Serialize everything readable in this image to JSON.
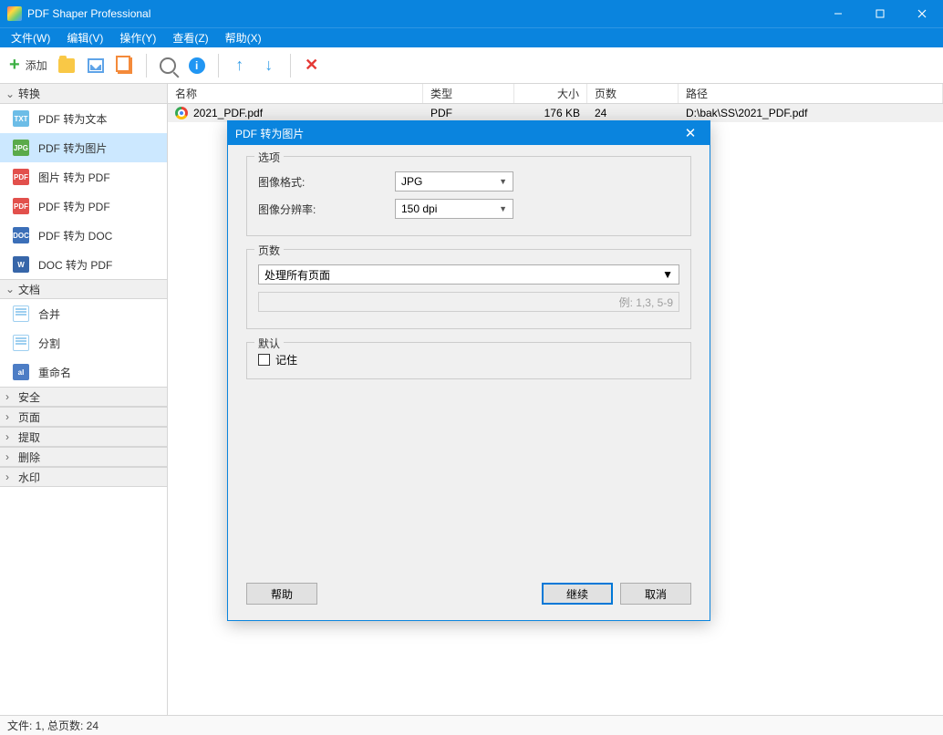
{
  "window": {
    "title": "PDF Shaper Professional"
  },
  "menubar": {
    "file": "文件(W)",
    "edit": "编辑(V)",
    "action": "操作(Y)",
    "view": "查看(Z)",
    "help": "帮助(X)"
  },
  "toolbar": {
    "add_label": "添加"
  },
  "sidebar": {
    "sections": {
      "convert": "转换",
      "document": "文档",
      "security": "安全",
      "page": "页面",
      "extract": "提取",
      "delete": "删除",
      "watermark": "水印"
    },
    "convert_items": {
      "pdf_to_text": "PDF 转为文本",
      "pdf_to_image": "PDF 转为图片",
      "image_to_pdf": "图片 转为 PDF",
      "pdf_to_pdf": "PDF 转为 PDF",
      "pdf_to_doc": "PDF 转为 DOC",
      "doc_to_pdf": "DOC 转为 PDF"
    },
    "document_items": {
      "merge": "合并",
      "split": "分割",
      "rename": "重命名"
    }
  },
  "table": {
    "headers": {
      "name": "名称",
      "type": "类型",
      "size": "大小",
      "pages": "页数",
      "path": "路径"
    },
    "row": {
      "name": "2021_PDF.pdf",
      "type": "PDF",
      "size": "176 KB",
      "pages": "24",
      "path": "D:\\bak\\SS\\2021_PDF.pdf"
    }
  },
  "dialog": {
    "title": "PDF 转为图片",
    "options_legend": "选项",
    "image_format_label": "图像格式:",
    "image_format_value": "JPG",
    "image_dpi_label": "图像分辨率:",
    "image_dpi_value": "150 dpi",
    "pages_legend": "页数",
    "pages_mode": "处理所有页面",
    "pages_range_placeholder": "例: 1,3, 5-9",
    "default_legend": "默认",
    "remember_label": "记住",
    "help_btn": "帮助",
    "continue_btn": "继续",
    "cancel_btn": "取消"
  },
  "statusbar": {
    "text": "文件: 1, 总页数: 24"
  }
}
